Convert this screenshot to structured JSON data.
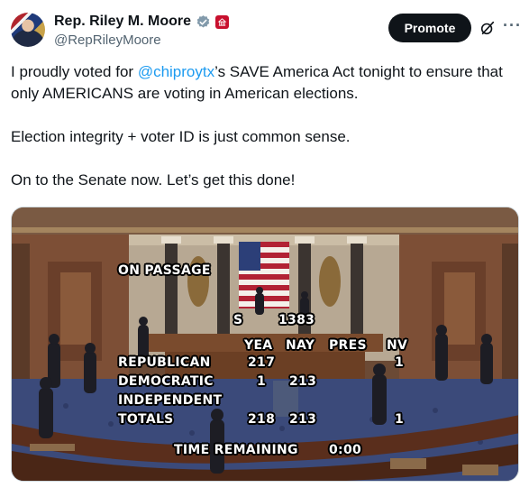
{
  "author": {
    "display_name": "Rep. Riley M. Moore",
    "handle": "@RepRileyMoore"
  },
  "actions": {
    "promote_label": "Promote",
    "more_label": "···"
  },
  "tweet": {
    "line1_before": "I proudly voted for ",
    "line1_mention": "@chiproytx",
    "line1_after": "’s SAVE America Act tonight to ensure that only AMERICANS are voting in American elections.",
    "paragraph2": "Election integrity + voter ID is just common sense.",
    "paragraph3": "On to the Senate now. Let’s get this done!"
  },
  "media": {
    "on_passage": "ON PASSAGE",
    "bill": "S",
    "bill_number": "1383",
    "col_yea": "YEA",
    "col_nay": "NAY",
    "col_pres": "PRES",
    "col_nv": "NV",
    "row_republican": "REPUBLICAN",
    "rep_yea": "217",
    "rep_nv": "1",
    "row_democratic": "DEMOCRATIC",
    "dem_yea": "1",
    "dem_nay": "213",
    "row_independent": "INDEPENDENT",
    "row_totals": "TOTALS",
    "tot_yea": "218",
    "tot_nay": "213",
    "tot_nv": "1",
    "time_label": "TIME REMAINING",
    "time_value": "0:00"
  }
}
